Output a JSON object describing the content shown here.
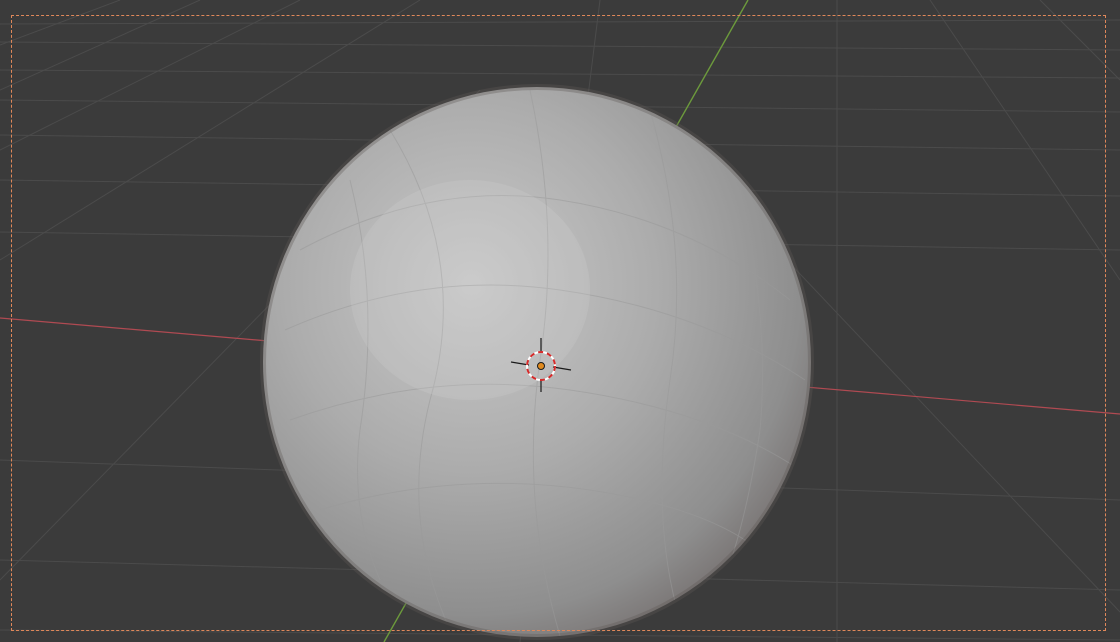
{
  "viewport": {
    "background_color": "#3b3b3b",
    "grid_color": "#4a4a4a",
    "x_axis_color": "#b04a52",
    "y_axis_color": "#6c9a3c",
    "camera_frame_color": "#e0885a"
  },
  "object": {
    "shape": "uv-sphere",
    "color": "#a8a8a8",
    "shading": "flat"
  },
  "cursor": {
    "icon": "3d-cursor-icon",
    "ring_color_a": "#d42a2a",
    "ring_color_b": "#ffffff",
    "origin_color": "#e08a1e"
  }
}
